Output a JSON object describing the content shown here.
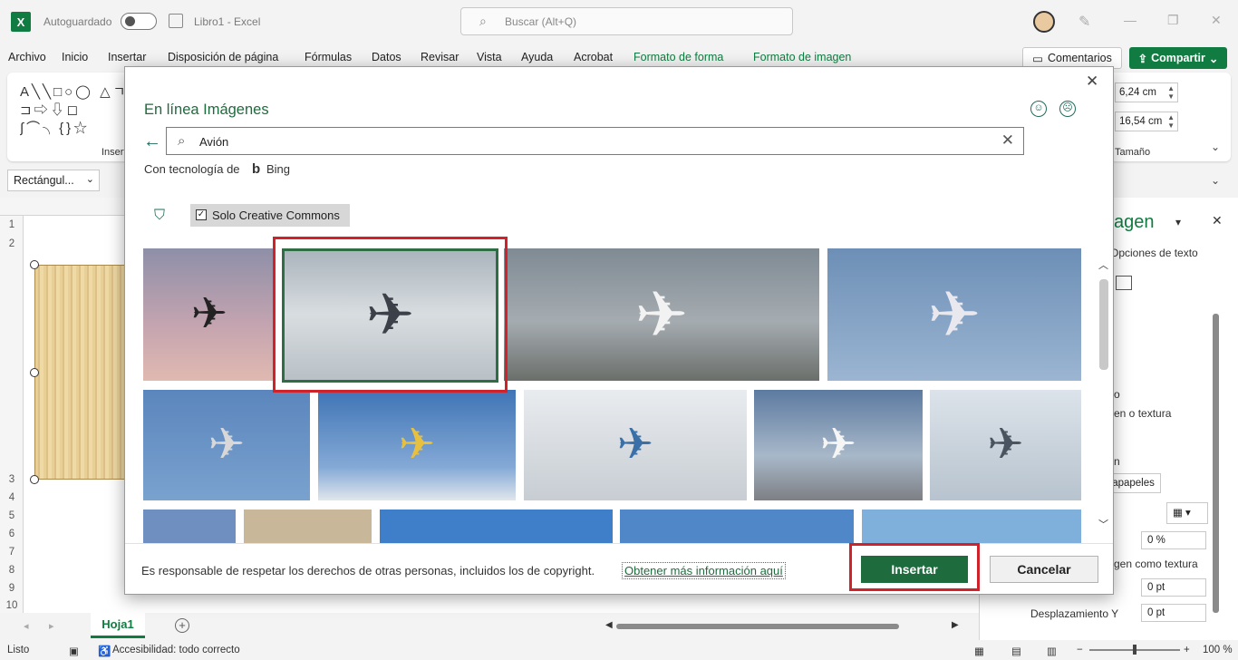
{
  "titlebar": {
    "app_icon": "X",
    "autosave_label": "Autoguardado",
    "doc_title": "Libro1  -  Excel",
    "search_placeholder": "Buscar (Alt+Q)"
  },
  "menu": {
    "items": [
      "Archivo",
      "Inicio",
      "Insertar",
      "Disposición de página",
      "Fórmulas",
      "Datos",
      "Revisar",
      "Vista",
      "Ayuda",
      "Acrobat",
      "Formato de forma",
      "Formato de imagen"
    ],
    "comments_label": "Comentarios",
    "share_label": "Compartir"
  },
  "ribbon": {
    "shapes_symbols": "A╲╲□○◯ △ㄱ⊐⇨⇩◻ ∫⌒╮{}☆",
    "group_label": "Insertar",
    "height_value": "6,24 cm",
    "width_value": "16,54 cm",
    "size_label": "Tamaño"
  },
  "formula": {
    "namebox_value": "Rectángul..."
  },
  "sheet": {
    "row_numbers": [
      "1",
      "2",
      "3",
      "4",
      "5",
      "6",
      "7",
      "8",
      "9",
      "10"
    ],
    "tab_label": "Hoja1",
    "add_label": "+"
  },
  "status": {
    "ready": "Listo",
    "accessibility": "Accesibilidad: todo correcto",
    "zoom": "100 %"
  },
  "right_pane": {
    "title": "agen",
    "options_text": "Opciones de texto",
    "texture_text": "en o textura",
    "p_text": "o",
    "n_text": "n",
    "clipboard_label": "tapapeles",
    "transparency_value": "0 %",
    "tile_text": "gen como textura",
    "offset_x_value": "0 pt",
    "offset_y_label": "Desplazamiento Y",
    "offset_y_value": "0 pt"
  },
  "dialog": {
    "title": "En línea Imágenes",
    "search_value": "Avión",
    "powered_by": "Con tecnología de",
    "bing_label": "Bing",
    "filter_label": "Solo Creative Commons",
    "disclaimer": "Es responsable de respetar los derechos de otras personas, incluidos los de copyright.",
    "more_info_link": "Obtener más información aquí",
    "insert_label": "Insertar",
    "cancel_label": "Cancelar"
  },
  "icons": {
    "search": "⌕",
    "clear": "✕",
    "close": "✕",
    "back": "←",
    "filter": "⛉",
    "plane": "✈",
    "happy": "☺",
    "sad": "☹"
  },
  "colors": {
    "excel_green": "#107c41",
    "dialog_green": "#1e6c3d",
    "highlight_red": "#d0222b"
  }
}
